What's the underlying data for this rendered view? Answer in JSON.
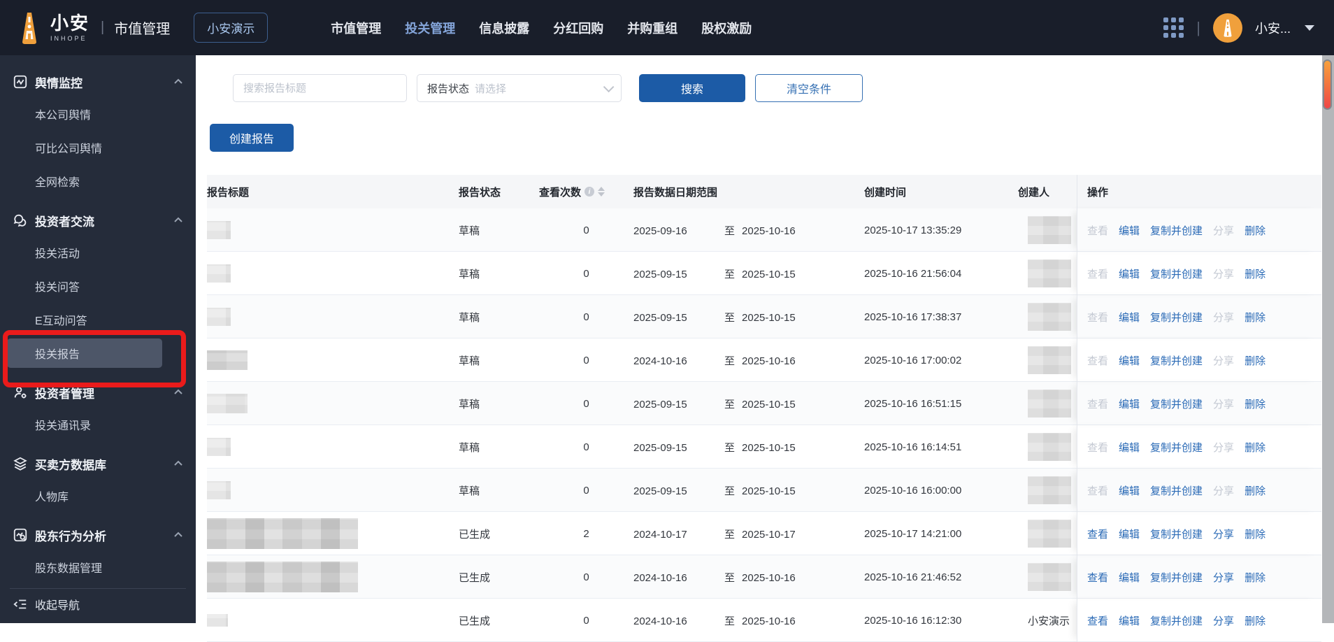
{
  "topbar": {
    "brand_name": "小安",
    "brand_sub": "INHOPE",
    "brand_divider": "|",
    "product": "市值管理",
    "env_badge": "小安演示",
    "nav": [
      {
        "label": "市值管理",
        "active": false
      },
      {
        "label": "投关管理",
        "active": true
      },
      {
        "label": "信息披露",
        "active": false
      },
      {
        "label": "分红回购",
        "active": false
      },
      {
        "label": "并购重组",
        "active": false
      },
      {
        "label": "股权激励",
        "active": false
      }
    ],
    "divider": "|",
    "user_name": "小安..."
  },
  "sidebar": {
    "sections": [
      {
        "label": "舆情监控",
        "icon": "pulse-square-icon",
        "items": [
          {
            "label": "本公司舆情"
          },
          {
            "label": "可比公司舆情"
          },
          {
            "label": "全网检索"
          }
        ]
      },
      {
        "label": "投资者交流",
        "icon": "chat-bubbles-icon",
        "items": [
          {
            "label": "投关活动"
          },
          {
            "label": "投关问答"
          },
          {
            "label": "E互动问答"
          },
          {
            "label": "投关报告",
            "selected": true
          }
        ]
      },
      {
        "label": "投资者管理",
        "icon": "person-gear-icon",
        "items": [
          {
            "label": "投关通讯录"
          }
        ]
      },
      {
        "label": "买卖方数据库",
        "icon": "layers-icon",
        "items": [
          {
            "label": "人物库"
          }
        ]
      },
      {
        "label": "股东行为分析",
        "icon": "chart-magnifier-icon",
        "items": [
          {
            "label": "股东数据管理"
          }
        ]
      }
    ],
    "collapse_label": "收起导航"
  },
  "filters": {
    "search_placeholder": "搜索报告标题",
    "select_label": "报告状态",
    "select_placeholder": "请选择",
    "search_button": "搜索",
    "clear_button": "清空条件",
    "create_button": "创建报告"
  },
  "table": {
    "columns": {
      "title": "报告标题",
      "status": "报告状态",
      "views": "查看次数",
      "range": "报告数据日期范围",
      "created": "创建时间",
      "creator": "创建人",
      "actions": "操作"
    },
    "range_sep": "至",
    "actions": {
      "view": "查看",
      "edit": "编辑",
      "copy": "复制并创建",
      "share": "分享",
      "delete": "删除"
    },
    "rows": [
      {
        "title_redaction": "sm",
        "status": "草稿",
        "views": "0",
        "date_from": "2025-09-16",
        "date_to": "2025-10-16",
        "created_at": "2025-10-17 13:35:29",
        "creator": "",
        "creator_redacted": true,
        "draft_actions_muted": true
      },
      {
        "title_redaction": "sm",
        "status": "草稿",
        "views": "0",
        "date_from": "2025-09-15",
        "date_to": "2025-10-15",
        "created_at": "2025-10-16 21:56:04",
        "creator": "",
        "creator_redacted": true,
        "draft_actions_muted": true
      },
      {
        "title_redaction": "sm",
        "status": "草稿",
        "views": "0",
        "date_from": "2025-09-15",
        "date_to": "2025-10-15",
        "created_at": "2025-10-16 17:38:37",
        "creator": "",
        "creator_redacted": true,
        "draft_actions_muted": true
      },
      {
        "title_redaction": "md-dark",
        "status": "草稿",
        "views": "0",
        "date_from": "2024-10-16",
        "date_to": "2025-10-16",
        "created_at": "2025-10-16 17:00:02",
        "creator": "",
        "creator_redacted": true,
        "draft_actions_muted": true
      },
      {
        "title_redaction": "md",
        "status": "草稿",
        "views": "0",
        "date_from": "2025-09-15",
        "date_to": "2025-10-15",
        "created_at": "2025-10-16 16:51:15",
        "creator": "",
        "creator_redacted": true,
        "draft_actions_muted": true
      },
      {
        "title_redaction": "sm",
        "status": "草稿",
        "views": "0",
        "date_from": "2025-09-15",
        "date_to": "2025-10-15",
        "created_at": "2025-10-16 16:14:51",
        "creator": "",
        "creator_redacted": true,
        "draft_actions_muted": true
      },
      {
        "title_redaction": "sm",
        "status": "草稿",
        "views": "0",
        "date_from": "2025-09-15",
        "date_to": "2025-10-15",
        "created_at": "2025-10-16 16:00:00",
        "creator": "",
        "creator_redacted": true,
        "draft_actions_muted": true
      },
      {
        "title_redaction": "wide",
        "status": "已生成",
        "views": "2",
        "date_from": "2024-10-17",
        "date_to": "2025-10-17",
        "created_at": "2025-10-17 14:21:00",
        "creator": "",
        "creator_redacted": true,
        "draft_actions_muted": false
      },
      {
        "title_redaction": "wide",
        "status": "已生成",
        "views": "0",
        "date_from": "2024-10-16",
        "date_to": "2025-10-16",
        "created_at": "2025-10-16 21:46:52",
        "creator": "",
        "creator_redacted": true,
        "draft_actions_muted": false
      },
      {
        "title_redaction": "xs",
        "status": "已生成",
        "views": "0",
        "date_from": "2024-10-16",
        "date_to": "2025-10-16",
        "created_at": "2025-10-16 16:12:30",
        "creator": "小安演示",
        "creator_redacted": false,
        "draft_actions_muted": false
      }
    ]
  },
  "annotation": {
    "color": "#ea1b1b"
  },
  "colors": {
    "topbar_bg": "#191e2a",
    "sidebar_bg": "#252c3a",
    "primary_blue": "#1c5ba6",
    "link_blue": "#2a6ab6",
    "disabled_link": "#c3c8d2",
    "brand_orange": "#f0a03c",
    "scroll_thumb_top": "#f7a13d",
    "scroll_thumb_bottom": "#ee4648"
  }
}
